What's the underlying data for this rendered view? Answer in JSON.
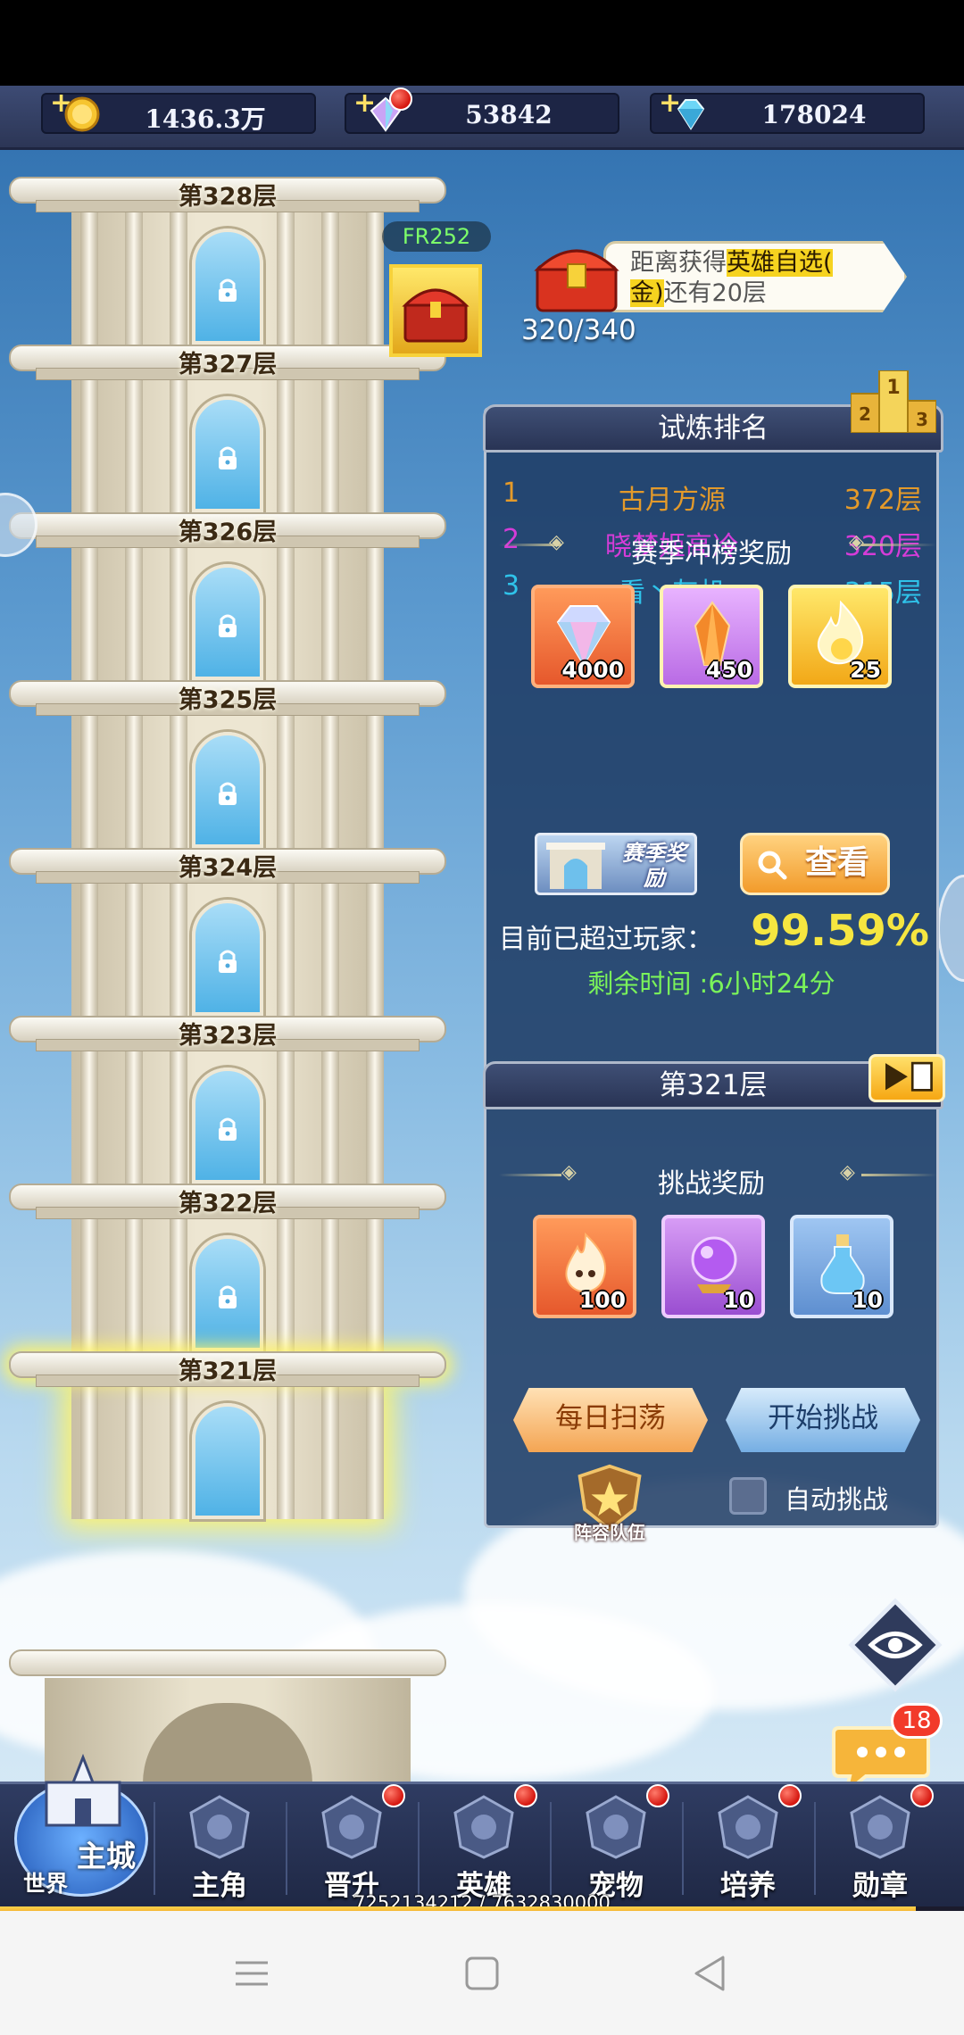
{
  "currency": {
    "gold": "1436.3万",
    "crystal": "53842",
    "diamond": "178024"
  },
  "tower": {
    "floors": [
      "第328层",
      "第327层",
      "第326层",
      "第325层",
      "第324层",
      "第323层",
      "第322层",
      "第321层"
    ],
    "current_floor_index": 7
  },
  "fr_tag": "FR252",
  "reward_note": {
    "prefix": "距离获得",
    "highlight_a": "英雄自选(",
    "highlight_b": "金)",
    "suffix": "还有20层",
    "progress": "320/340"
  },
  "ranking": {
    "title": "试炼排名",
    "rows": [
      {
        "pos": "1",
        "name": "古月方源",
        "floor": "372层",
        "color": "#e49a2a"
      },
      {
        "pos": "2",
        "name": "晓梦姬高冷",
        "floor": "320层",
        "color": "#d53cd8"
      },
      {
        "pos": "3",
        "name": "看丶灰机",
        "floor": "315层",
        "color": "#2fc3ea"
      }
    ],
    "season_title": "赛季冲榜奖励",
    "rewards": [
      {
        "icon": "rainbow-diamond-icon",
        "count": "4000"
      },
      {
        "icon": "orange-crystal-icon",
        "count": "450"
      },
      {
        "icon": "golden-flame-icon",
        "count": "25"
      }
    ],
    "season_btn": "赛季奖励",
    "view_btn": "查看",
    "exceed_label": "目前已超过玩家：",
    "exceed_value": "99.59%",
    "remaining": "剩余时间 :6小时24分"
  },
  "challenge": {
    "title": "第321层",
    "reward_title": "挑战奖励",
    "rewards": [
      {
        "icon": "spirit-flame-icon",
        "count": "100"
      },
      {
        "icon": "purple-orb-icon",
        "count": "10"
      },
      {
        "icon": "potion-bottle-icon",
        "count": "10"
      }
    ],
    "sweep_btn": "每日扫荡",
    "start_btn": "开始挑战",
    "lineup": "阵容队伍",
    "auto_label": "自动挑战"
  },
  "chat_badge": "18",
  "nav": {
    "home_main": "主城",
    "home_world": "世界",
    "items": [
      {
        "label": "主角",
        "dot": false
      },
      {
        "label": "晋升",
        "dot": true
      },
      {
        "label": "英雄",
        "dot": true
      },
      {
        "label": "宠物",
        "dot": true
      },
      {
        "label": "培养",
        "dot": true
      },
      {
        "label": "勋章",
        "dot": true
      }
    ]
  },
  "exp": {
    "text": "7252134212 / 7632830000",
    "fraction": 0.95
  },
  "colors": {
    "accent_gold": "#f6e640",
    "remain_green": "#7af35a",
    "panel_bg": "#1d3a63"
  }
}
